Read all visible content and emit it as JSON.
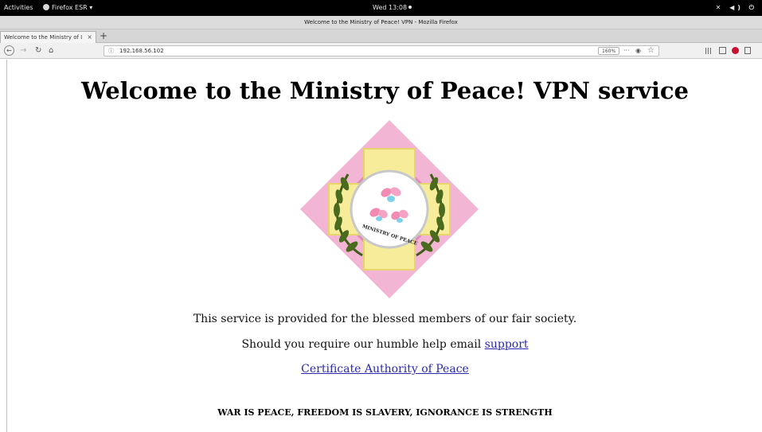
{
  "topbar": {
    "activities": "Activities",
    "app_menu": "Firefox ESR ▾",
    "clock": "Wed 13:08",
    "tray": "✕ ◀) ⏻"
  },
  "window": {
    "title": "Welcome to the Ministry of Peace! VPN - Mozilla Firefox"
  },
  "tabs": [
    {
      "label": "Welcome to the Ministry of I",
      "close": "×"
    }
  ],
  "new_tab": "+",
  "navbar": {
    "url": "192.168.56.102",
    "zoom": "160%",
    "page_actions": "···"
  },
  "page": {
    "heading": "Welcome to the Ministry of Peace! VPN service",
    "logo_text": "MINISTRY OF PEACE",
    "line1": "This service is provided for the blessed members of our fair society.",
    "line2_prefix": "Should you require our humble help email ",
    "support_link": "support",
    "ca_link": "Certificate Authority of Peace",
    "slogan": "WAR IS PEACE, FREEDOM IS SLAVERY, IGNORANCE IS STRENGTH"
  },
  "colors": {
    "link": "#2a2ab0",
    "diamond_outer": "#f2b6d4",
    "diamond_inner": "#e38cba",
    "cross": "#f7ec9a",
    "laurel": "#4a6a1e"
  }
}
